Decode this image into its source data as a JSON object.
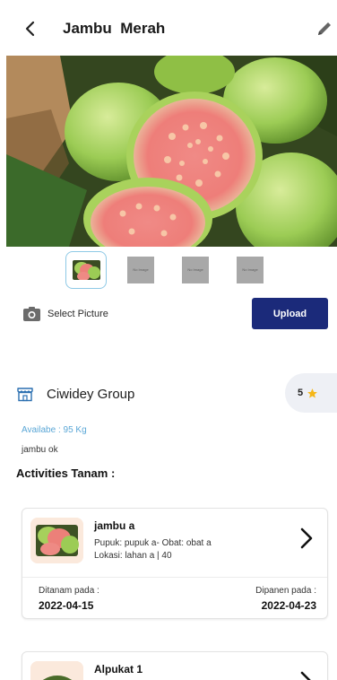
{
  "header": {
    "title": "Jambu  Merah",
    "back_icon": "chevron-left-icon",
    "edit_icon": "pencil-icon"
  },
  "gallery": {
    "thumbnails": [
      {
        "type": "photo",
        "selected": true
      },
      {
        "type": "placeholder",
        "text": "No Image"
      },
      {
        "type": "placeholder",
        "text": "No Image"
      },
      {
        "type": "placeholder",
        "text": "No Image"
      }
    ]
  },
  "upload": {
    "select_label": "Select Picture",
    "button_label": "Upload",
    "camera_icon": "camera-icon"
  },
  "group": {
    "name": "Ciwidey Group",
    "icon": "store-icon",
    "rating": "5",
    "rating_icon": "star-icon"
  },
  "product": {
    "available": "Availabe : 95 Kg",
    "description": "jambu ok"
  },
  "activities": {
    "title": "Activities Tanam :",
    "items": [
      {
        "name": "jambu a",
        "line1": "Pupuk: pupuk a- Obat: obat a",
        "line2": "Lokasi: lahan a | 40",
        "planted_label": "Ditanam pada :",
        "planted_date": "2022-04-15",
        "harvest_label": "Dipanen pada :",
        "harvest_date": "2022-04-23"
      },
      {
        "name": "Alpukat 1"
      }
    ]
  },
  "colors": {
    "accent_button": "#1b2a7a",
    "available_text": "#5ba7d6",
    "star": "#f5b719",
    "rating_bg": "#eef0f5"
  }
}
